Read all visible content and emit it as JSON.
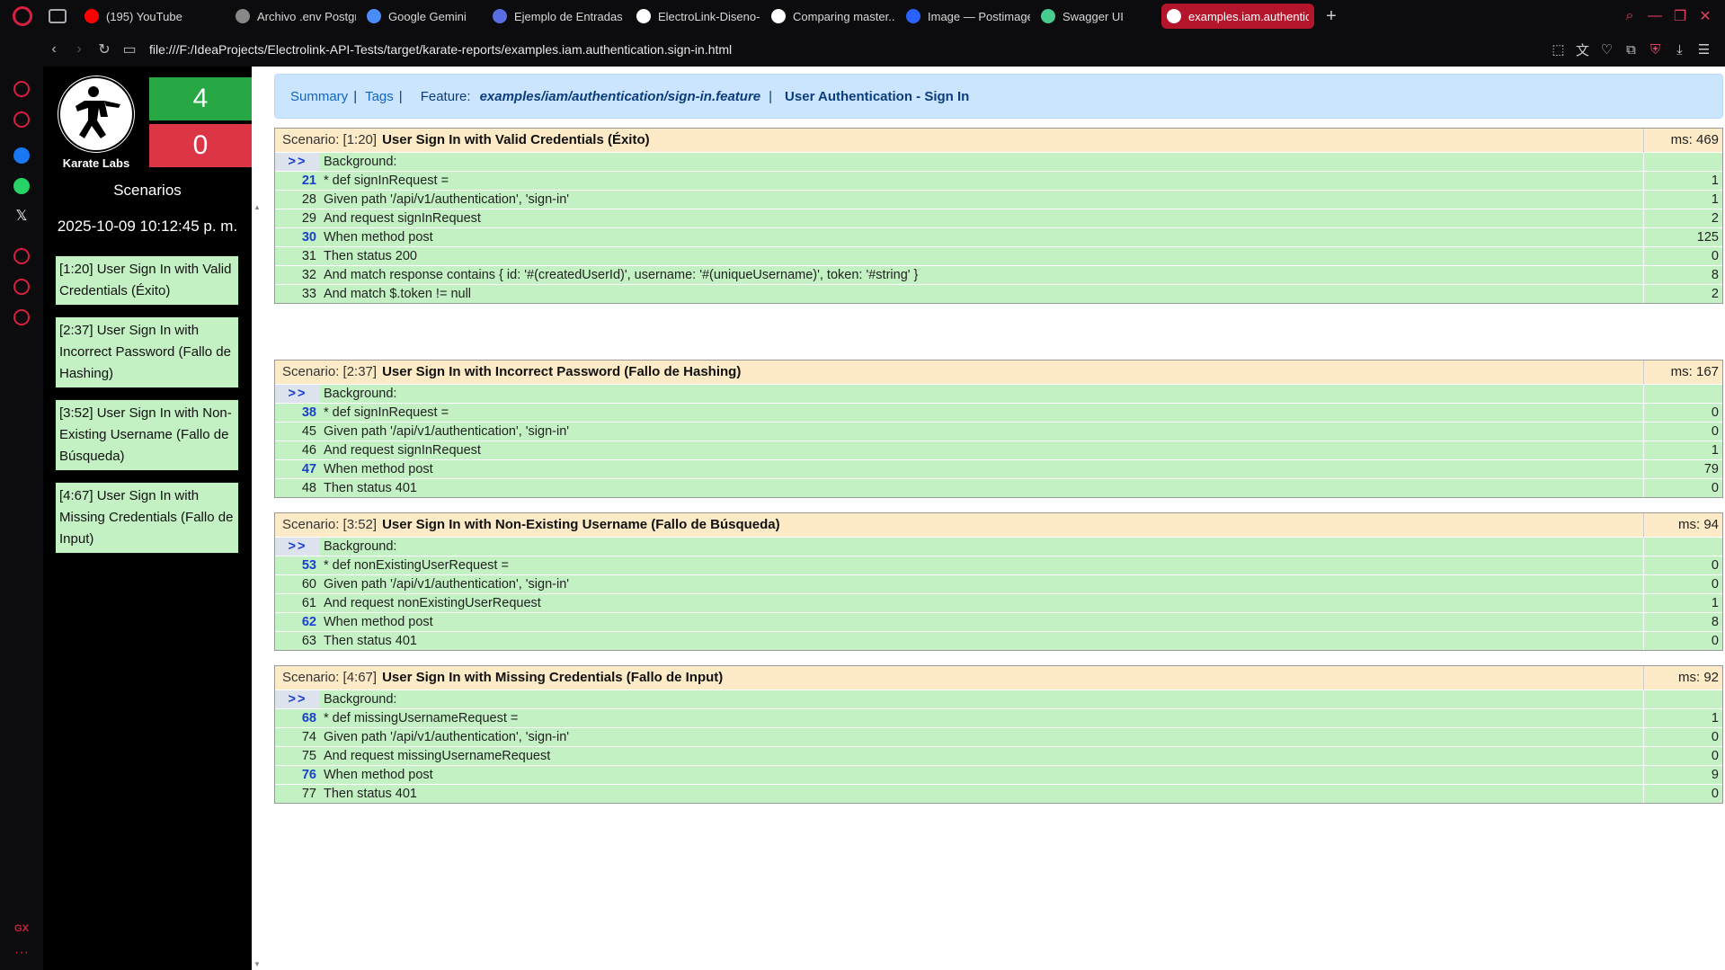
{
  "browser": {
    "tabs": [
      {
        "label": "(195) YouTube",
        "icon": "youtube-icon",
        "color": "#ff0000"
      },
      {
        "label": "Archivo .env PostgreSQL",
        "icon": "chatgpt-icon",
        "color": "#888888"
      },
      {
        "label": "Google Gemini",
        "icon": "gemini-icon",
        "color": "#4a8df8"
      },
      {
        "label": "Ejemplo de Entradas JSON",
        "icon": "app-icon",
        "color": "#5b6ee1"
      },
      {
        "label": "ElectroLink-Diseno-de-",
        "icon": "github-icon",
        "color": "#ffffff"
      },
      {
        "label": "Comparing master...dev",
        "icon": "github-icon",
        "color": "#ffffff"
      },
      {
        "label": "Image — Postimages",
        "icon": "postimages-icon",
        "color": "#2962ff"
      },
      {
        "label": "Swagger UI",
        "icon": "swagger-icon",
        "color": "#49cc90"
      },
      {
        "label": "examples.iam.authenticati",
        "icon": "karate-icon",
        "color": "#ffffff",
        "active": true
      }
    ],
    "url": "file:///F:/IdeaProjects/Electrolink-API-Tests/target/karate-reports/examples.iam.authentication.sign-in.html"
  },
  "sidebar": {
    "logo_text": "Karate Labs",
    "passed": "4",
    "failed": "0",
    "heading": "Scenarios",
    "date": "2025-10-09 10:12:45 p. m.",
    "scenarios": [
      "[1:20] User Sign In with Valid Credentials (Éxito)",
      "[2:37] User Sign In with Incorrect Password (Fallo de Hashing)",
      "[3:52] User Sign In with Non-Existing Username (Fallo de Búsqueda)",
      "[4:67] User Sign In with Missing Credentials (Fallo de Input)"
    ]
  },
  "header": {
    "summary": "Summary",
    "tags": "Tags",
    "feature_label": "Feature:",
    "feature_file": "examples/iam/authentication/sign-in.feature",
    "feature_title": "User Authentication - Sign In"
  },
  "scenarios": [
    {
      "label": "Scenario: [1:20]",
      "name": "User Sign In with Valid Credentials (Éxito)",
      "ms": "ms: 469",
      "steps": [
        {
          "line": ">>",
          "text": "Background:",
          "ms": "",
          "bg": true
        },
        {
          "line": "21",
          "text": "* def signInRequest =",
          "ms": "1",
          "hi": true
        },
        {
          "line": "28",
          "text": "Given path '/api/v1/authentication', 'sign-in'",
          "ms": "1"
        },
        {
          "line": "29",
          "text": "And request signInRequest",
          "ms": "2"
        },
        {
          "line": "30",
          "text": "When method post",
          "ms": "125",
          "hi": true
        },
        {
          "line": "31",
          "text": "Then status 200",
          "ms": "0"
        },
        {
          "line": "32",
          "text": "And match response contains { id: '#(createdUserId)', username: '#(uniqueUsername)', token: '#string' }",
          "ms": "8"
        },
        {
          "line": "33",
          "text": "And match $.token != null",
          "ms": "2"
        }
      ]
    },
    {
      "label": "Scenario: [2:37]",
      "name": "User Sign In with Incorrect Password (Fallo de Hashing)",
      "ms": "ms: 167",
      "steps": [
        {
          "line": ">>",
          "text": "Background:",
          "ms": "",
          "bg": true
        },
        {
          "line": "38",
          "text": "* def signInRequest =",
          "ms": "0",
          "hi": true
        },
        {
          "line": "45",
          "text": "Given path '/api/v1/authentication', 'sign-in'",
          "ms": "0"
        },
        {
          "line": "46",
          "text": "And request signInRequest",
          "ms": "1"
        },
        {
          "line": "47",
          "text": "When method post",
          "ms": "79",
          "hi": true
        },
        {
          "line": "48",
          "text": "Then status 401",
          "ms": "0"
        }
      ]
    },
    {
      "label": "Scenario: [3:52]",
      "name": "User Sign In with Non-Existing Username (Fallo de Búsqueda)",
      "ms": "ms: 94",
      "steps": [
        {
          "line": ">>",
          "text": "Background:",
          "ms": "",
          "bg": true
        },
        {
          "line": "53",
          "text": "* def nonExistingUserRequest =",
          "ms": "0",
          "hi": true
        },
        {
          "line": "60",
          "text": "Given path '/api/v1/authentication', 'sign-in'",
          "ms": "0"
        },
        {
          "line": "61",
          "text": "And request nonExistingUserRequest",
          "ms": "1"
        },
        {
          "line": "62",
          "text": "When method post",
          "ms": "8",
          "hi": true
        },
        {
          "line": "63",
          "text": "Then status 401",
          "ms": "0"
        }
      ]
    },
    {
      "label": "Scenario: [4:67]",
      "name": "User Sign In with Missing Credentials (Fallo de Input)",
      "ms": "ms: 92",
      "steps": [
        {
          "line": ">>",
          "text": "Background:",
          "ms": "",
          "bg": true
        },
        {
          "line": "68",
          "text": "* def missingUsernameRequest =",
          "ms": "1",
          "hi": true
        },
        {
          "line": "74",
          "text": "Given path '/api/v1/authentication', 'sign-in'",
          "ms": "0"
        },
        {
          "line": "75",
          "text": "And request missingUsernameRequest",
          "ms": "0"
        },
        {
          "line": "76",
          "text": "When method post",
          "ms": "9",
          "hi": true
        },
        {
          "line": "77",
          "text": "Then status 401",
          "ms": "0"
        }
      ]
    }
  ]
}
